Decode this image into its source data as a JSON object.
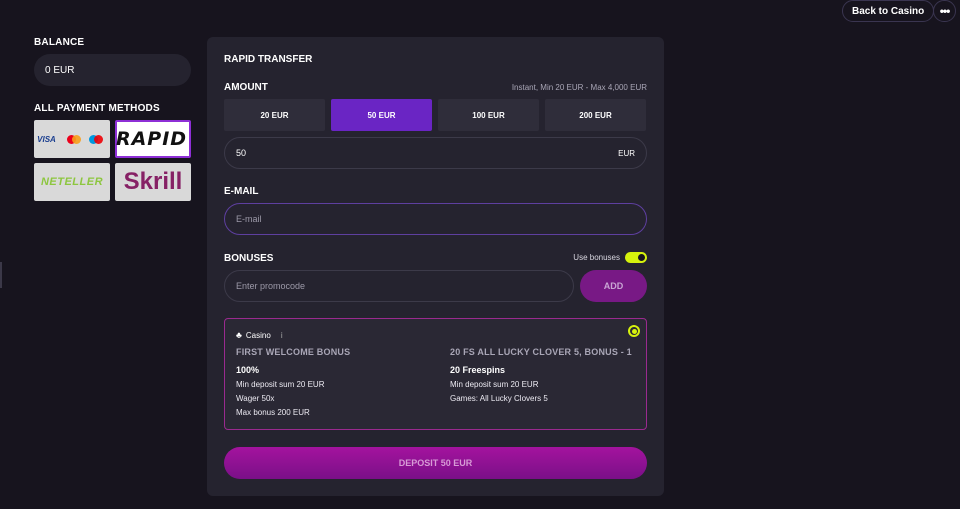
{
  "header": {
    "back_label": "Back to Casino",
    "more_label": "•••"
  },
  "sidebar": {
    "balance_label": "BALANCE",
    "balance_value": "0 EUR",
    "methods_label": "ALL PAYMENT METHODS",
    "methods": [
      {
        "name": "cards",
        "text": "VISA",
        "selected": false
      },
      {
        "name": "rapid",
        "text": "RAPID",
        "selected": true
      },
      {
        "name": "neteller",
        "text": "NETELLER",
        "selected": false
      },
      {
        "name": "skrill",
        "text": "Skrill",
        "selected": false
      }
    ]
  },
  "panel": {
    "title": "RAPID TRANSFER",
    "amount_label": "AMOUNT",
    "limits": "Instant, Min 20 EUR - Max 4,000 EUR",
    "amount_options": [
      "20 EUR",
      "50 EUR",
      "100 EUR",
      "200 EUR"
    ],
    "selected_amount_index": 1,
    "amount_value": "50",
    "currency": "EUR",
    "email_label": "E-MAIL",
    "email_placeholder": "E-mail",
    "bonuses_label": "BONUSES",
    "use_bonuses_label": "Use bonuses",
    "use_bonuses_on": true,
    "promo_placeholder": "Enter promocode",
    "add_label": "ADD",
    "bonus_card": {
      "category": "Casino",
      "info_icon": "i",
      "left": {
        "title": "FIRST WELCOME BONUS",
        "value": "100%",
        "lines": [
          "Min deposit sum 20 EUR",
          "Wager 50x",
          "Max bonus 200 EUR"
        ]
      },
      "right": {
        "title": "20 FS ALL LUCKY CLOVER 5, BONUS - 1",
        "value": "20 Freespins",
        "lines": [
          "Min deposit sum 20 EUR",
          "Games: All Lucky Clovers 5"
        ]
      }
    },
    "deposit_label": "DEPOSIT 50 EUR"
  },
  "colors": {
    "background": "#17141e",
    "panel": "#25232f",
    "accent_purple": "#6a25c4",
    "accent_magenta": "#a4139e",
    "toggle_lime": "#d6f20d"
  }
}
